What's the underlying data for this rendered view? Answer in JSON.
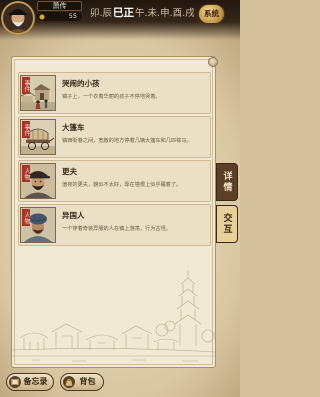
{
  "player": {
    "name": "萧传",
    "currency": "55",
    "avatar_icon": "old-man-portrait-icon",
    "currency_icon": "coin-icon"
  },
  "time_bar": {
    "before": "卯.辰",
    "current": "巳正",
    "after": "午.未.申.酉.戌"
  },
  "system_button": {
    "label": "系统"
  },
  "tabs": [
    {
      "label": "详情",
      "active": true
    },
    {
      "label": "交互",
      "active": false
    }
  ],
  "entries": [
    {
      "tag": "事件",
      "title": "哭闹的小孩",
      "desc": "镇子上，一个衣着华丽的孩子不停地哭着。",
      "portrait_icon": "street-scene-icon"
    },
    {
      "tag": "事件",
      "title": "大篷车",
      "desc": "镇西街巷之间，宽敞的地方停着几辆大篷车和几匹棕马。",
      "portrait_icon": "covered-wagon-icon"
    },
    {
      "tag": "人物",
      "title": "更夫",
      "desc": "值夜的更夫，貌似不太好，靠在墙根上似乎睡着了。",
      "portrait_icon": "watchman-portrait-icon"
    },
    {
      "tag": "人物",
      "title": "异国人",
      "desc": "一个穿着奇装异服的人在镇上游荡，行为古怪。",
      "portrait_icon": "foreigner-portrait-icon"
    }
  ],
  "bottom_buttons": [
    {
      "label": "备忘录",
      "icon": "scroll-icon"
    },
    {
      "label": "背包",
      "icon": "bag-icon"
    }
  ],
  "colors": {
    "tag_red": "#a8352a",
    "tab_active": "#5b3f27",
    "tab_inactive": "#e7d09a",
    "parchment": "#f2e9d4",
    "title_text": "#3b2a1a"
  }
}
